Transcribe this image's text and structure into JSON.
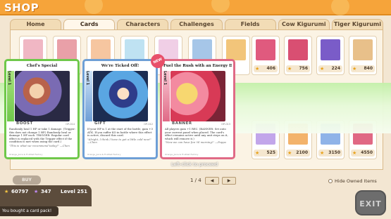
{
  "header": {
    "title": "SHOP"
  },
  "tabs": [
    {
      "label": "Home"
    },
    {
      "label": "Cards"
    },
    {
      "label": "Characters"
    },
    {
      "label": "Challenges"
    },
    {
      "label": "Fields"
    },
    {
      "label": "Cow Kigurumi"
    },
    {
      "label": "Tiger Kigurumi"
    }
  ],
  "grid": {
    "row1_prices": [
      "406",
      "756",
      "224",
      "840"
    ],
    "row2_prices": [
      "525",
      "2100",
      "3150",
      "4550"
    ]
  },
  "cards": [
    {
      "name": "Chef's Special",
      "level": "Level 1",
      "type": "BOOST",
      "num": "OP-014",
      "text": "Randomly heal 1 HP or take 1 damage. (Trigger: this does not change 1 HP.) Randomly heal or damage 1 HP each. TRIGGER: Regular card effect is replaced with the Trigger effect if the condition is met when using the card.)",
      "flavor": "\"This is what we recommend today!\" —Chen",
      "foot": "Orange_Juice & Fruitbat Factory",
      "color": "green"
    },
    {
      "name": "We're Ticked Off!",
      "level": "Level 1",
      "type": "GIFT",
      "num": "OP-012",
      "text": "If your HP is 1 at the start of the battle, gain +3 ATK. If you suffer KO in battle where this effect is active, discard this card.",
      "flavor": "\"Alright, I think I have to get a little cold now!\" —Chen",
      "foot": "Orange_Juice & Fruitbat Factory",
      "color": "blue"
    },
    {
      "name": "Fuel the Rush with an Energy Drink",
      "level": "Level 1",
      "type": "BANNER",
      "num": "OP-013",
      "text": "All players gain +1 REC. (BANNER: Set onto your current panel when placed. The card's effect remains active until any unit steps on it, which will remove it.)",
      "flavor": "\"Now we can have fun 'til morning!\" —Poppo",
      "foot": "Orange_Juice & Fruitbat Factory",
      "color": "pink"
    }
  ],
  "badge": "NEW",
  "hint": "Left-click to proceed",
  "pager": {
    "text": "1 / 4",
    "prev": "◀",
    "next": "▶"
  },
  "hide_owned_label": "Hide Owned Items",
  "ok_label": "BUY",
  "stats": {
    "stars": "60797",
    "wins": "347",
    "level": "Level 251"
  },
  "exit_label": "EXIT",
  "toast": "You bought a card pack!"
}
